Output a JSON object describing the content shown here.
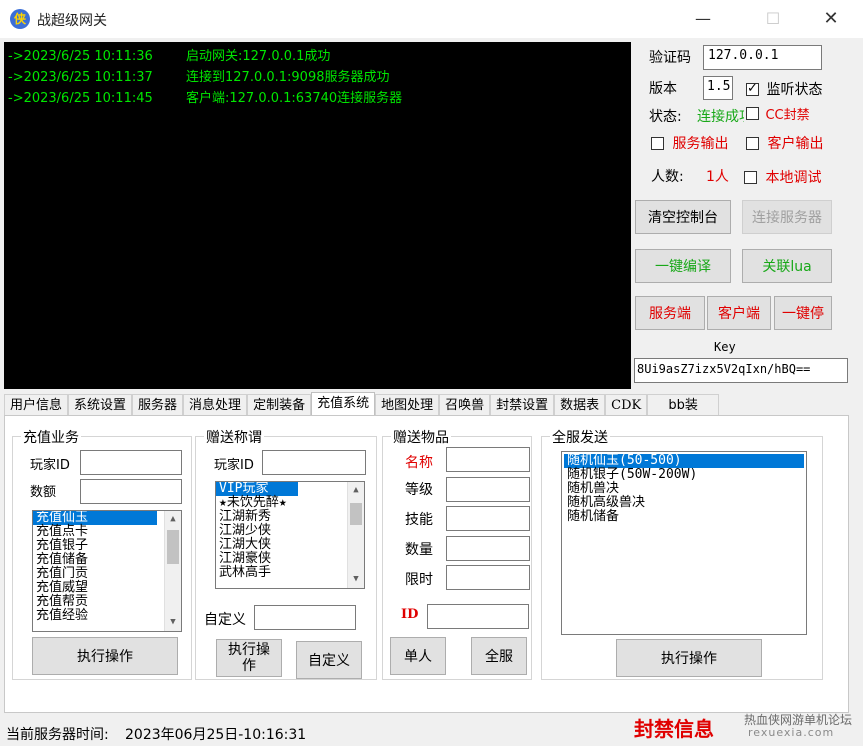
{
  "window": {
    "title": "战超级网关",
    "icon": "app-logo-icon"
  },
  "console": {
    "lines": [
      {
        "ts": "->2023/6/25 10:11:36",
        "msg": "启动网关:127.0.0.1成功"
      },
      {
        "ts": "->2023/6/25 10:11:37",
        "msg": "连接到127.0.0.1:9098服务器成功"
      },
      {
        "ts": "->2023/6/25 10:11:45",
        "msg": "客户端:127.0.0.1:63740连接服务器"
      }
    ]
  },
  "right": {
    "verify_label": "验证码",
    "verify_value": "127.0.0.1",
    "version_label": "版本",
    "version_value": "1.5",
    "listen_label": "监听状态",
    "status_label": "状态:",
    "status_value": "连接成功",
    "cc_label": "CC封禁",
    "service_out_label": "服务输出",
    "client_out_label": "客户输出",
    "count_label": "人数:",
    "count_value": "1人",
    "local_debug_label": "本地调试",
    "clear_btn": "清空控制台",
    "connect_btn": "连接服务器",
    "compile_btn": "一键编译",
    "lua_btn": "关联lua",
    "server_btn": "服务端",
    "client_btn": "客户端",
    "stop_btn": "一键停",
    "key_label": "Key",
    "key_value": "8Ui9asZ7izx5V2qIxn/hBQ=="
  },
  "tabs": [
    "用户信息",
    "系统设置",
    "服务器",
    "消息处理",
    "定制装备",
    "充值系统",
    "地图处理",
    "召唤兽",
    "封禁设置",
    "数据表",
    "CDK",
    "bb装"
  ],
  "active_tab": "充值系统",
  "recharge": {
    "title": "充值业务",
    "player_id_label": "玩家ID",
    "amount_label": "数额",
    "items": [
      "充值仙玉",
      "充值点卡",
      "充值银子",
      "充值储备",
      "充值门贡",
      "充值威望",
      "充值帮贡",
      "充值经验"
    ],
    "exec_btn": "执行操作"
  },
  "titlegift": {
    "title": "赠送称谓",
    "player_id_label": "玩家ID",
    "items": [
      "VIP玩家",
      "★未饮先醉★",
      "江湖新秀",
      "江湖少侠",
      "江湖大侠",
      "江湖豪侠",
      "武林高手"
    ],
    "custom_label": "自定义",
    "exec_btn": "执行操作",
    "custom_btn": "自定义"
  },
  "itemgift": {
    "title": "赠送物品",
    "name_label": "名称",
    "level_label": "等级",
    "skill_label": "技能",
    "qty_label": "数量",
    "limit_label": "限时",
    "id_label": "ID",
    "single_btn": "单人",
    "all_btn": "全服"
  },
  "broadcast": {
    "title": "全服发送",
    "items": [
      "随机仙玉(50-500)",
      "随机银子(50W-200W)",
      "随机兽决",
      "随机高级兽决",
      "随机储备"
    ],
    "exec_btn": "执行操作"
  },
  "status": {
    "time_label": "当前服务器时间:",
    "time_value": "2023年06月25日-10:16:31",
    "ban_info": "封禁信息",
    "watermark": "热血侠网游单机论坛",
    "watermark_url": "rexuexia.com"
  }
}
